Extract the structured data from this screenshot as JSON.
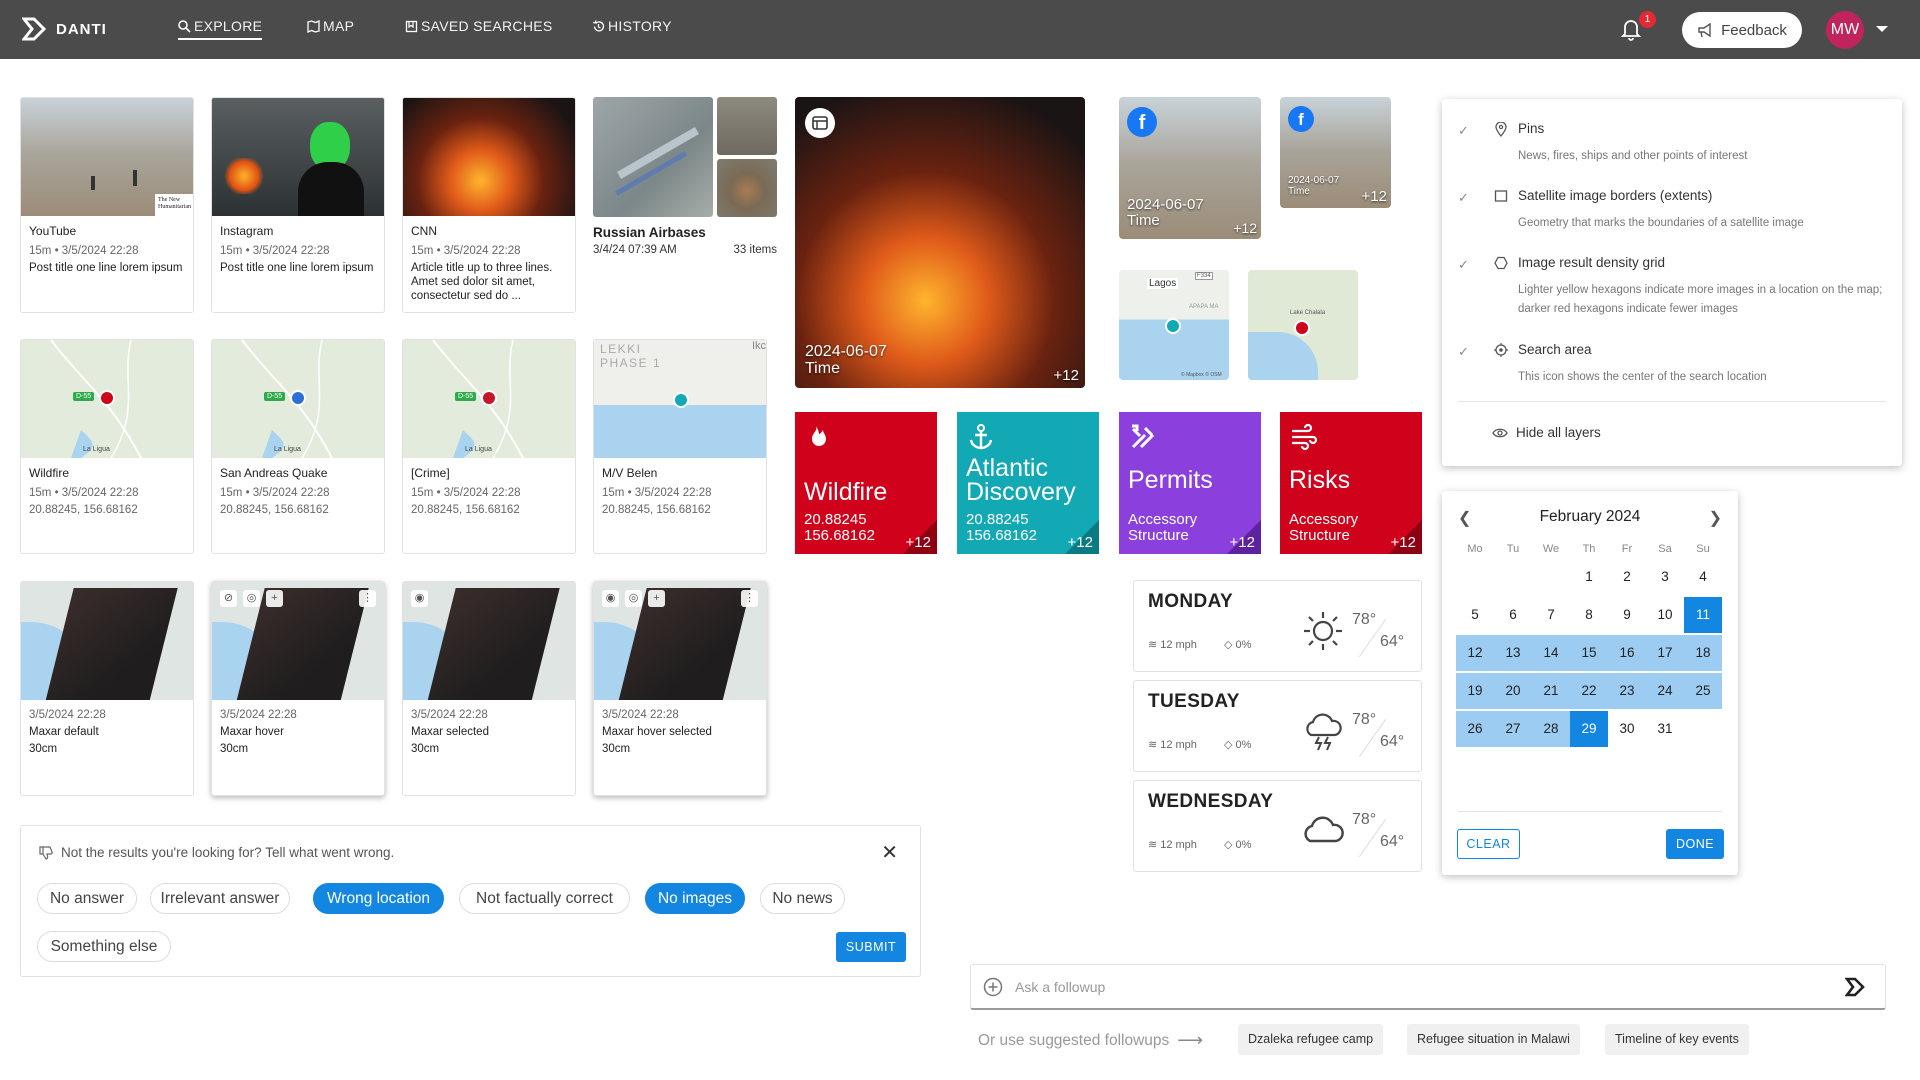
{
  "app": {
    "name": "DANTI"
  },
  "nav": {
    "explore": "EXPLORE",
    "map": "MAP",
    "saved": "SAVED SEARCHES",
    "history": "HISTORY"
  },
  "topbar": {
    "notif_count": "1",
    "feedback": "Feedback",
    "avatar": "MW"
  },
  "news_cards": [
    {
      "source": "YouTube",
      "meta": "15m • 3/5/2024 22:28",
      "text": "Post title one line lorem ipsum",
      "watermark": "The New Humanitarian"
    },
    {
      "source": "Instagram",
      "meta": "15m • 3/5/2024 22:28",
      "text": "Post title one line lorem ipsum"
    },
    {
      "source": "CNN",
      "meta": "15m • 3/5/2024 22:28",
      "text": "Article title up to three lines. Amet sed dolor sit amet, consectetur sed do ..."
    }
  ],
  "collection": {
    "title": "Russian Airbases",
    "date": "3/4/24  07:39 AM",
    "count": "33 items"
  },
  "big_image": {
    "date": "2024-06-07",
    "label": "Time",
    "plus": "+12"
  },
  "fb_images": [
    {
      "date": "2024-06-07",
      "label": "Time",
      "plus": "+12"
    },
    {
      "date": "2024-06-07",
      "label": "Time",
      "plus": "+12"
    }
  ],
  "mini_maps": [
    {
      "city": "Lagos",
      "road": "F334",
      "district": "APAPA MA",
      "credit": "© Mapbox © OSM"
    },
    {
      "place": "Lake Chalala"
    }
  ],
  "event_cards": [
    {
      "title": "Wildfire",
      "meta": "15m • 3/5/2024 22:28",
      "coords": "20.88245, 156.68162",
      "badge": "D-55",
      "place": "La Ligua"
    },
    {
      "title": "San Andreas Quake",
      "meta": "15m • 3/5/2024 22:28",
      "coords": "20.88245, 156.68162",
      "badge": "D-55",
      "place": "La Ligua"
    },
    {
      "title": "[Crime]",
      "meta": "15m • 3/5/2024 22:28",
      "coords": "20.88245, 156.68162",
      "badge": "D-55",
      "place": "La Ligua"
    },
    {
      "title": "M/V Belen",
      "meta": "15m • 3/5/2024 22:28",
      "coords": "20.88245, 156.68162",
      "district": "LEKKI PHASE 1",
      "edge": "Ikc"
    }
  ],
  "tiles": [
    {
      "title": "Wildfire",
      "l1": "20.88245",
      "l2": "156.68162",
      "plus": "+12",
      "color": "#d0021b"
    },
    {
      "title": "Atlantic Discovery",
      "l1": "20.88245",
      "l2": "156.68162",
      "plus": "+12",
      "color": "#12a9b4"
    },
    {
      "title": "Permits",
      "l1": "Accessory",
      "l2": "Structure",
      "plus": "+12",
      "color": "#8b3fdc"
    },
    {
      "title": "Risks",
      "l1": "Accessory",
      "l2": "Structure",
      "plus": "+12",
      "color": "#d0021b"
    }
  ],
  "sat_cards": [
    {
      "date": "3/5/2024 22:28",
      "name": "Maxar default",
      "res": "30cm"
    },
    {
      "date": "3/5/2024 22:28",
      "name": "Maxar hover",
      "res": "30cm"
    },
    {
      "date": "3/5/2024 22:28",
      "name": "Maxar selected",
      "res": "30cm"
    },
    {
      "date": "3/5/2024 22:28",
      "name": "Maxar hover selected",
      "res": "30cm"
    }
  ],
  "weather": [
    {
      "day": "MONDAY",
      "wind": "12 mph",
      "rain": "0%",
      "hi": "78°",
      "lo": "64°",
      "icon": "sun-icon"
    },
    {
      "day": "TUESDAY",
      "wind": "12 mph",
      "rain": "0%",
      "hi": "78°",
      "lo": "64°",
      "icon": "thunderstorm-icon"
    },
    {
      "day": "WEDNESDAY",
      "wind": "12 mph",
      "rain": "0%",
      "hi": "78°",
      "lo": "64°",
      "icon": "cloud-icon"
    }
  ],
  "layers": {
    "items": [
      {
        "title": "Pins",
        "desc": "News, fires, ships and other points of interest",
        "icon": "pin-icon"
      },
      {
        "title": "Satellite image borders (extents)",
        "desc": "Geometry that marks the boundaries of a satellite image",
        "icon": "square-icon"
      },
      {
        "title": "Image result density grid",
        "desc": "Lighter yellow hexagons indicate more images in a location on the map; darker red hexagons indicate fewer images",
        "icon": "hexagon-icon"
      },
      {
        "title": "Search area",
        "desc": "This icon shows the center of the search location",
        "icon": "target-icon"
      }
    ],
    "hide_all": "Hide all layers"
  },
  "calendar": {
    "month": "February 2024",
    "weekdays": [
      "Mo",
      "Tu",
      "We",
      "Th",
      "Fr",
      "Sa",
      "Su"
    ],
    "days": [
      "1",
      "2",
      "3",
      "4",
      "5",
      "6",
      "7",
      "8",
      "9",
      "10",
      "11",
      "12",
      "13",
      "14",
      "15",
      "16",
      "17",
      "18",
      "19",
      "20",
      "21",
      "22",
      "23",
      "24",
      "25",
      "26",
      "27",
      "28",
      "29",
      "30",
      "31"
    ],
    "clear": "CLEAR",
    "done": "DONE"
  },
  "feedback": {
    "question": "Not the results you're looking for? Tell what went wrong.",
    "options": [
      "No answer",
      "Irrelevant answer",
      "Wrong location",
      "Not factually correct",
      "No images",
      "No news",
      "Something else"
    ],
    "submit": "SUBMIT"
  },
  "followup": {
    "placeholder": "Ask a followup",
    "suggest_label": "Or use suggested followups",
    "suggestions": [
      "Dzaleka refugee camp",
      "Refugee situation in Malawi",
      "Timeline of key events"
    ]
  }
}
